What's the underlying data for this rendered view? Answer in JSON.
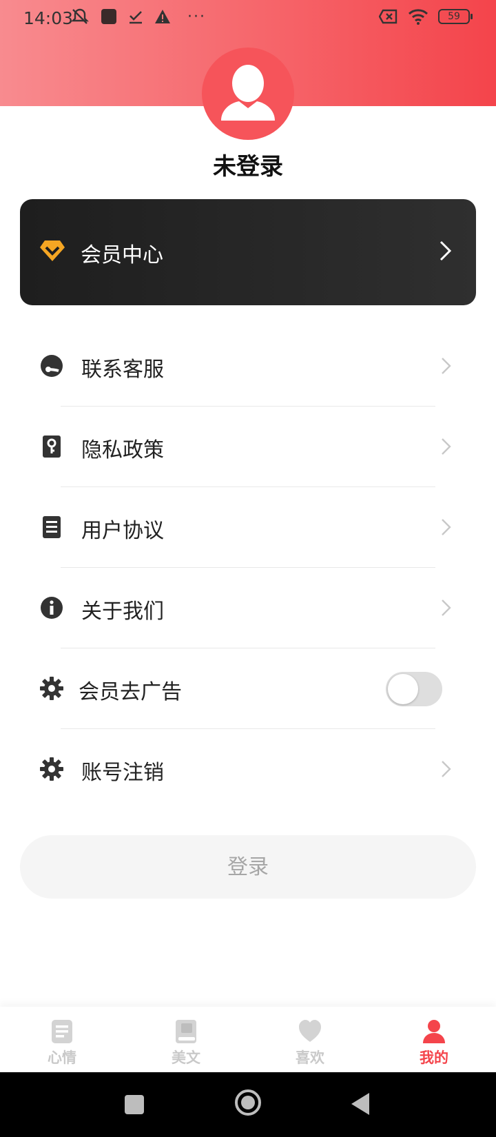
{
  "status_bar": {
    "time": "14:03",
    "battery": "59",
    "icons_left": [
      "mute-icon",
      "app-icon",
      "download-done-icon",
      "warning-icon",
      "more-dots-icon"
    ],
    "icons_right": [
      "sim-error-icon",
      "wifi-icon",
      "battery-icon"
    ],
    "dots": "···"
  },
  "profile": {
    "name": "未登录"
  },
  "vip": {
    "label": "会员中心",
    "icon": "diamond-icon",
    "accent": "#f5a623"
  },
  "menu": {
    "items": [
      {
        "label": "联系客服",
        "icon": "customer-service-icon"
      },
      {
        "label": "隐私政策",
        "icon": "privacy-key-icon"
      },
      {
        "label": "用户协议",
        "icon": "document-icon"
      },
      {
        "label": "关于我们",
        "icon": "info-icon"
      },
      {
        "label": "会员去广告",
        "icon": "gear-icon",
        "toggle": false
      },
      {
        "label": "账号注销",
        "icon": "gear-icon"
      }
    ]
  },
  "login": {
    "label": "登录"
  },
  "tabbar": {
    "items": [
      {
        "label": "心情",
        "icon": "note-icon",
        "active": false
      },
      {
        "label": "美文",
        "icon": "book-icon",
        "active": false
      },
      {
        "label": "喜欢",
        "icon": "heart-icon",
        "active": false
      },
      {
        "label": "我的",
        "icon": "person-icon",
        "active": true
      }
    ]
  },
  "colors": {
    "brand": "#f4444b",
    "header_gradient_start": "#f88b8f",
    "header_gradient_end": "#f4444b",
    "vip_card": "#1e1e1e",
    "inactive_tab": "#c9c9c9"
  }
}
